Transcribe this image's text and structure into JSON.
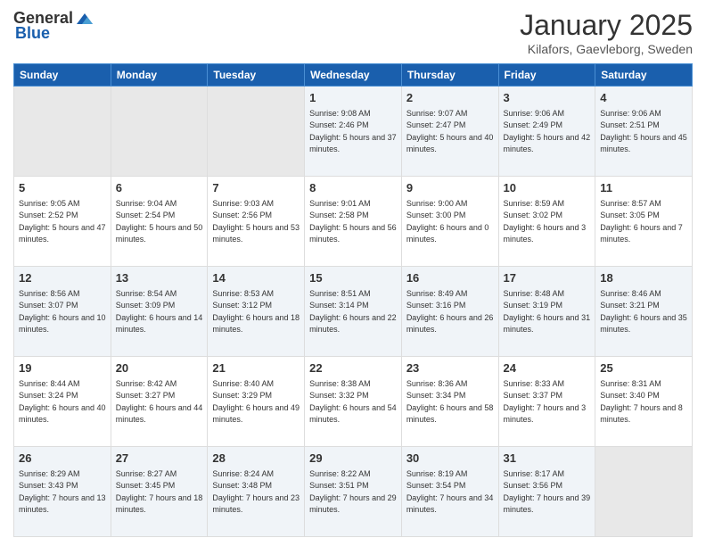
{
  "header": {
    "logo_general": "General",
    "logo_blue": "Blue",
    "month_title": "January 2025",
    "location": "Kilafors, Gaevleborg, Sweden"
  },
  "days_of_week": [
    "Sunday",
    "Monday",
    "Tuesday",
    "Wednesday",
    "Thursday",
    "Friday",
    "Saturday"
  ],
  "weeks": [
    [
      {
        "day": "",
        "details": ""
      },
      {
        "day": "",
        "details": ""
      },
      {
        "day": "",
        "details": ""
      },
      {
        "day": "1",
        "details": "Sunrise: 9:08 AM\nSunset: 2:46 PM\nDaylight: 5 hours and 37 minutes."
      },
      {
        "day": "2",
        "details": "Sunrise: 9:07 AM\nSunset: 2:47 PM\nDaylight: 5 hours and 40 minutes."
      },
      {
        "day": "3",
        "details": "Sunrise: 9:06 AM\nSunset: 2:49 PM\nDaylight: 5 hours and 42 minutes."
      },
      {
        "day": "4",
        "details": "Sunrise: 9:06 AM\nSunset: 2:51 PM\nDaylight: 5 hours and 45 minutes."
      }
    ],
    [
      {
        "day": "5",
        "details": "Sunrise: 9:05 AM\nSunset: 2:52 PM\nDaylight: 5 hours and 47 minutes."
      },
      {
        "day": "6",
        "details": "Sunrise: 9:04 AM\nSunset: 2:54 PM\nDaylight: 5 hours and 50 minutes."
      },
      {
        "day": "7",
        "details": "Sunrise: 9:03 AM\nSunset: 2:56 PM\nDaylight: 5 hours and 53 minutes."
      },
      {
        "day": "8",
        "details": "Sunrise: 9:01 AM\nSunset: 2:58 PM\nDaylight: 5 hours and 56 minutes."
      },
      {
        "day": "9",
        "details": "Sunrise: 9:00 AM\nSunset: 3:00 PM\nDaylight: 6 hours and 0 minutes."
      },
      {
        "day": "10",
        "details": "Sunrise: 8:59 AM\nSunset: 3:02 PM\nDaylight: 6 hours and 3 minutes."
      },
      {
        "day": "11",
        "details": "Sunrise: 8:57 AM\nSunset: 3:05 PM\nDaylight: 6 hours and 7 minutes."
      }
    ],
    [
      {
        "day": "12",
        "details": "Sunrise: 8:56 AM\nSunset: 3:07 PM\nDaylight: 6 hours and 10 minutes."
      },
      {
        "day": "13",
        "details": "Sunrise: 8:54 AM\nSunset: 3:09 PM\nDaylight: 6 hours and 14 minutes."
      },
      {
        "day": "14",
        "details": "Sunrise: 8:53 AM\nSunset: 3:12 PM\nDaylight: 6 hours and 18 minutes."
      },
      {
        "day": "15",
        "details": "Sunrise: 8:51 AM\nSunset: 3:14 PM\nDaylight: 6 hours and 22 minutes."
      },
      {
        "day": "16",
        "details": "Sunrise: 8:49 AM\nSunset: 3:16 PM\nDaylight: 6 hours and 26 minutes."
      },
      {
        "day": "17",
        "details": "Sunrise: 8:48 AM\nSunset: 3:19 PM\nDaylight: 6 hours and 31 minutes."
      },
      {
        "day": "18",
        "details": "Sunrise: 8:46 AM\nSunset: 3:21 PM\nDaylight: 6 hours and 35 minutes."
      }
    ],
    [
      {
        "day": "19",
        "details": "Sunrise: 8:44 AM\nSunset: 3:24 PM\nDaylight: 6 hours and 40 minutes."
      },
      {
        "day": "20",
        "details": "Sunrise: 8:42 AM\nSunset: 3:27 PM\nDaylight: 6 hours and 44 minutes."
      },
      {
        "day": "21",
        "details": "Sunrise: 8:40 AM\nSunset: 3:29 PM\nDaylight: 6 hours and 49 minutes."
      },
      {
        "day": "22",
        "details": "Sunrise: 8:38 AM\nSunset: 3:32 PM\nDaylight: 6 hours and 54 minutes."
      },
      {
        "day": "23",
        "details": "Sunrise: 8:36 AM\nSunset: 3:34 PM\nDaylight: 6 hours and 58 minutes."
      },
      {
        "day": "24",
        "details": "Sunrise: 8:33 AM\nSunset: 3:37 PM\nDaylight: 7 hours and 3 minutes."
      },
      {
        "day": "25",
        "details": "Sunrise: 8:31 AM\nSunset: 3:40 PM\nDaylight: 7 hours and 8 minutes."
      }
    ],
    [
      {
        "day": "26",
        "details": "Sunrise: 8:29 AM\nSunset: 3:43 PM\nDaylight: 7 hours and 13 minutes."
      },
      {
        "day": "27",
        "details": "Sunrise: 8:27 AM\nSunset: 3:45 PM\nDaylight: 7 hours and 18 minutes."
      },
      {
        "day": "28",
        "details": "Sunrise: 8:24 AM\nSunset: 3:48 PM\nDaylight: 7 hours and 23 minutes."
      },
      {
        "day": "29",
        "details": "Sunrise: 8:22 AM\nSunset: 3:51 PM\nDaylight: 7 hours and 29 minutes."
      },
      {
        "day": "30",
        "details": "Sunrise: 8:19 AM\nSunset: 3:54 PM\nDaylight: 7 hours and 34 minutes."
      },
      {
        "day": "31",
        "details": "Sunrise: 8:17 AM\nSunset: 3:56 PM\nDaylight: 7 hours and 39 minutes."
      },
      {
        "day": "",
        "details": ""
      }
    ]
  ]
}
